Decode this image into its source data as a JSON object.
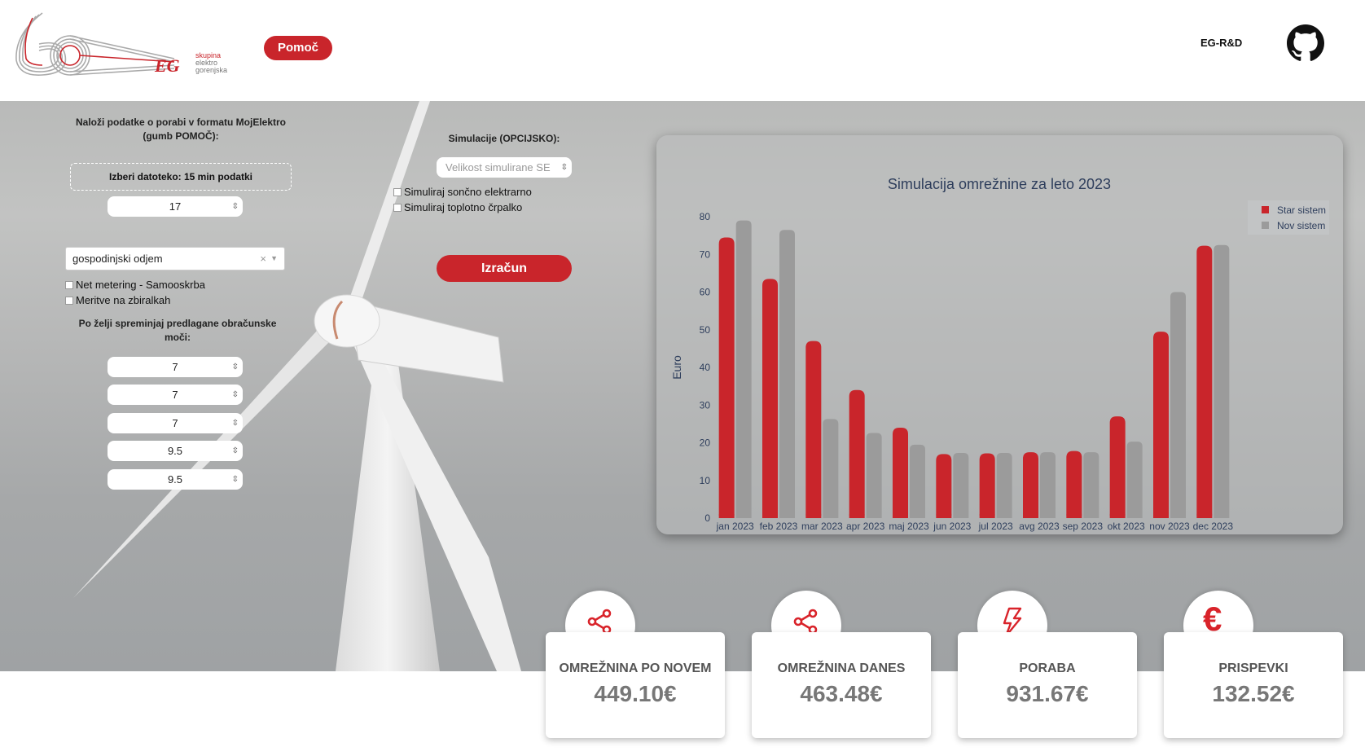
{
  "header": {
    "logo_text": [
      "skupina",
      "elektro",
      "gorenjska"
    ],
    "help_label": "Pomoč",
    "eg_link": "EG-R&D"
  },
  "form": {
    "upload_title": "Naloži podatke o porabi v formatu MojElektro (gumb POMOČ):",
    "file_button": "Izberi datoteko: 15 min podatki",
    "number_value": "17",
    "tariff_select": "gospodinjski odjem",
    "net_metering_label": "Net metering - Samooskrba",
    "busbar_label": "Meritve na zbiralkah",
    "power_title": "Po želji spreminjaj predlagane obračunske moči:",
    "powers": [
      "7",
      "7",
      "7",
      "9.5",
      "9.5"
    ]
  },
  "simulation": {
    "title": "Simulacije (OPCIJSKO):",
    "size_placeholder": "Velikost simulirane SE",
    "solar_label": "Simuliraj sončno elektrarno",
    "heatpump_label": "Simuliraj toplotno črpalko",
    "calc_label": "Izračun"
  },
  "chart_data": {
    "type": "bar",
    "title": "Simulacija omrežnine za leto 2023",
    "xlabel": "",
    "ylabel": "Euro",
    "ylim": [
      0,
      80
    ],
    "yticks": [
      0,
      10,
      20,
      30,
      40,
      50,
      60,
      70,
      80
    ],
    "categories": [
      "jan 2023",
      "feb 2023",
      "mar 2023",
      "apr 2023",
      "maj 2023",
      "jun 2023",
      "jul 2023",
      "avg 2023",
      "sep 2023",
      "okt 2023",
      "nov 2023",
      "dec 2023"
    ],
    "series": [
      {
        "name": "Star sistem",
        "color": "#c9252b",
        "values": [
          74.5,
          63.5,
          47,
          34,
          24,
          17,
          17.2,
          17.5,
          17.8,
          27,
          49.5,
          72.3
        ]
      },
      {
        "name": "Nov sistem",
        "color": "#9b9b9b",
        "values": [
          79,
          76.5,
          26.3,
          22.6,
          19.5,
          17.3,
          17.3,
          17.5,
          17.5,
          20.3,
          60,
          72.5
        ]
      }
    ],
    "legend_position": "top-right"
  },
  "stats": [
    {
      "label": "OMREŽNINA PO NOVEM",
      "value": "449.10€",
      "icon": "share-icon"
    },
    {
      "label": "OMREŽNINA DANES",
      "value": "463.48€",
      "icon": "share-icon"
    },
    {
      "label": "PORABA",
      "value": "931.67€",
      "icon": "lightning-icon"
    },
    {
      "label": "PRISPEVKI",
      "value": "132.52€",
      "icon": "euro-icon",
      "symbol": "€"
    }
  ],
  "colors": {
    "accent": "#c9252b",
    "old_series": "#c9252b",
    "new_series": "#9b9b9b"
  }
}
